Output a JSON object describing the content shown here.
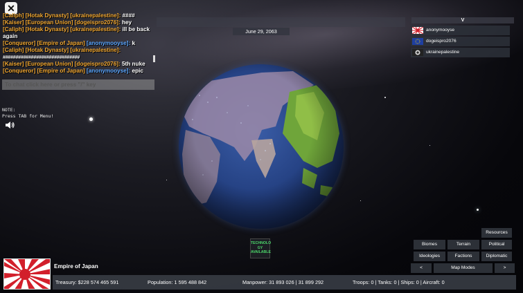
{
  "chat": {
    "lines": [
      {
        "title": "[Caliph]",
        "nation": "[Hotak Dynasty]",
        "user": "[ukrainepalestine]:",
        "message": " ####"
      },
      {
        "title": "[Kaiser]",
        "nation": "[European Union]",
        "user": "[dogeispro2076]:",
        "message": " hey"
      },
      {
        "title": "[Caliph]",
        "nation": "[Hotak Dynasty]",
        "user": "[ukrainepalestine]:",
        "message": " ill be back again"
      },
      {
        "title": "[Conqueror]",
        "nation": "[Empire of Japan]",
        "user": "[anonymooyse]:",
        "message": " k"
      },
      {
        "title": "[Caliph]",
        "nation": "[Hotak Dynasty]",
        "user": "[ukrainepalestine]:",
        "message": " ##############################"
      },
      {
        "title": "[Kaiser]",
        "nation": "[European Union]",
        "user": "[dogeispro2076]:",
        "message": " 5th nuke"
      },
      {
        "title": "[Conqueror]",
        "nation": "[Empire of Japan]",
        "user": "[anonymooyse]:",
        "message": " epic"
      }
    ],
    "input_placeholder": "To chat click here or press \"/\" key"
  },
  "note": {
    "line1": "NOTE:",
    "line2": "Press TAB for Menu!"
  },
  "top": {
    "date": "June 29, 2063"
  },
  "players": {
    "toggle_label": "V",
    "list": [
      {
        "name": "anonymooyse",
        "flag": "rising-sun-flag"
      },
      {
        "name": "dogeispro2076",
        "flag": "eu-flag"
      },
      {
        "name": "ukrainepalestine",
        "flag": "round-emblem-flag"
      }
    ]
  },
  "tech_badge": {
    "line1": "TECHNOLO",
    "line2": "GY",
    "line3": "AVAILABLE"
  },
  "map_modes": {
    "resources": "Resources",
    "biomes": "Biomes",
    "terrain": "Terrain",
    "political": "Political",
    "ideologies": "Ideologies",
    "factions": "Factions",
    "diplomatic": "Diplomatic",
    "prev": "<",
    "label": "Map Modes",
    "next": ">"
  },
  "country": {
    "name": "Empire of Japan",
    "treasury": "Treasury:  $228 574 465 591",
    "population": "Population: 1 595 488 842",
    "manpower": "Manpower:  31 893 026  |  31 899 292",
    "military": "Troops: 0  |  Tanks: 0  |  Ships: 0  |  Aircraft: 0"
  },
  "colors": {
    "chat_title": "#f0a630",
    "chat_user": "#5aa6ff",
    "tech_green": "#4cd86a",
    "panel_bg": "#30343c"
  }
}
